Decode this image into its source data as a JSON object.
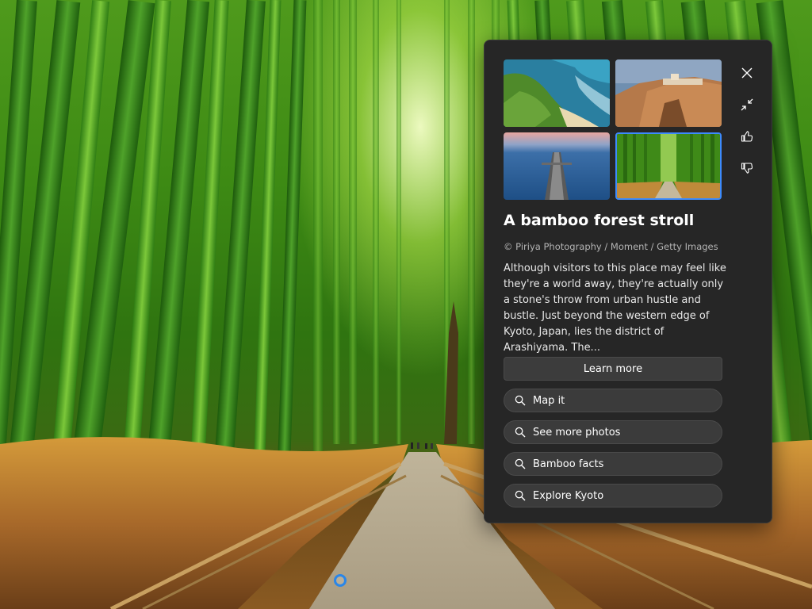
{
  "spotlight": {
    "title": "A bamboo forest stroll",
    "credit": "© Piriya Photography / Moment / Getty Images",
    "description": "Although visitors to this place may feel like they're a world away, they're actually only a stone's throw from urban hustle and bustle. Just beyond the western edge of Kyoto, Japan, lies the district of Arashiyama. The...",
    "learn_more_label": "Learn more",
    "suggestions": [
      {
        "label": "Map it",
        "icon": "search-icon"
      },
      {
        "label": "See more photos",
        "icon": "search-icon"
      },
      {
        "label": "Bamboo facts",
        "icon": "search-icon"
      },
      {
        "label": "Explore Kyoto",
        "icon": "search-icon"
      }
    ],
    "thumbnails": [
      {
        "name": "coastal-cliff-beach"
      },
      {
        "name": "cliff-town-bridge"
      },
      {
        "name": "pier-into-sea"
      },
      {
        "name": "bamboo-forest-path",
        "selected": true
      }
    ],
    "side_actions": [
      {
        "name": "close",
        "icon": "close-icon"
      },
      {
        "name": "collapse",
        "icon": "collapse-icon"
      },
      {
        "name": "like",
        "icon": "thumbs-up-icon"
      },
      {
        "name": "dislike",
        "icon": "thumbs-down-icon"
      }
    ],
    "accent_color": "#3d8bfd"
  }
}
